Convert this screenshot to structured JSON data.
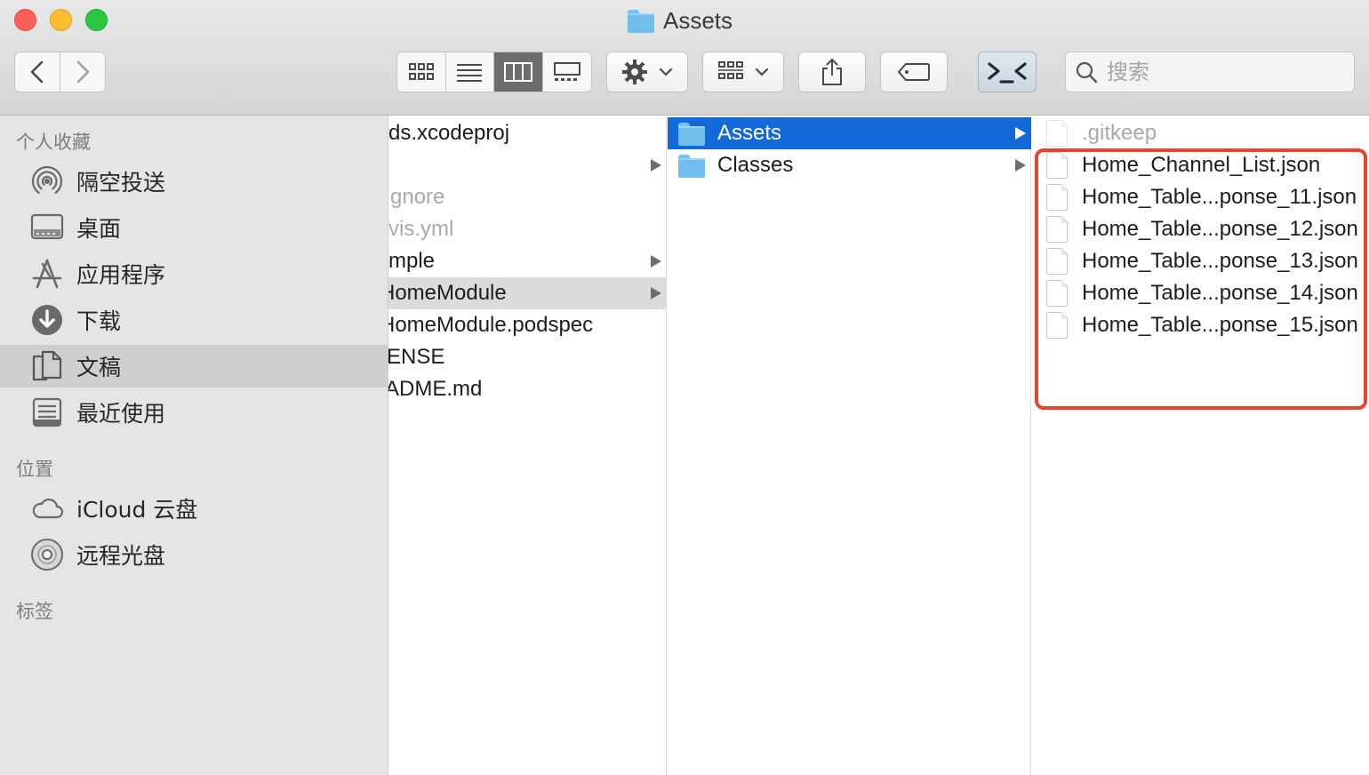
{
  "window": {
    "title": "Assets",
    "title_icon": "folder-icon"
  },
  "toolbar": {
    "back_icon": "chevron-left-icon",
    "forward_icon": "chevron-right-icon",
    "view_modes": [
      "icon-view-icon",
      "list-view-icon",
      "column-view-icon",
      "gallery-view-icon"
    ],
    "active_view": "column-view-icon",
    "action_icon": "gear-icon",
    "group_icon": "grid-group-icon",
    "share_icon": "share-icon",
    "tag_icon": "tag-icon",
    "terminal_icon": "terminal-icon",
    "search_placeholder": "搜索",
    "search_value": ""
  },
  "sidebar": {
    "favorites_header": "个人收藏",
    "favorites": [
      {
        "label": "隔空投送",
        "icon": "airdrop-icon"
      },
      {
        "label": "桌面",
        "icon": "desktop-icon"
      },
      {
        "label": "应用程序",
        "icon": "applications-icon"
      },
      {
        "label": "下载",
        "icon": "downloads-icon"
      },
      {
        "label": "文稿",
        "icon": "documents-icon",
        "selected": true
      },
      {
        "label": "最近使用",
        "icon": "recents-icon"
      }
    ],
    "locations_header": "位置",
    "locations": [
      {
        "label": "iCloud 云盘",
        "icon": "cloud-icon"
      },
      {
        "label": "远程光盘",
        "icon": "disc-icon"
      }
    ],
    "tags_header": "标签"
  },
  "columns": {
    "col1": [
      {
        "name": "ds.xcodeproj",
        "dim": false,
        "arrow": false
      },
      {
        "name": "",
        "dim": false,
        "arrow": true
      },
      {
        "name": "gnore",
        "dim": true,
        "arrow": false
      },
      {
        "name": "vis.yml",
        "dim": true,
        "arrow": false
      },
      {
        "name": "mple",
        "dim": false,
        "arrow": true
      },
      {
        "name": "HomeModule",
        "dim": false,
        "arrow": true,
        "selected": true
      },
      {
        "name": "HomeModule.podspec",
        "dim": false,
        "arrow": false
      },
      {
        "name": "ENSE",
        "dim": false,
        "arrow": false
      },
      {
        "name": "ADME.md",
        "dim": false,
        "arrow": false
      }
    ],
    "col2": [
      {
        "name": "Assets",
        "selected": true
      },
      {
        "name": "Classes",
        "selected": false
      }
    ],
    "col3": [
      {
        "name": ".gitkeep",
        "dim": true
      },
      {
        "name": "Home_Channel_List.json",
        "dim": false
      },
      {
        "name": "Home_Table...ponse_11.json",
        "dim": false
      },
      {
        "name": "Home_Table...ponse_12.json",
        "dim": false
      },
      {
        "name": "Home_Table...ponse_13.json",
        "dim": false
      },
      {
        "name": "Home_Table...ponse_14.json",
        "dim": false
      },
      {
        "name": "Home_Table...ponse_15.json",
        "dim": false
      }
    ]
  },
  "colors": {
    "selection_blue": "#1469d9",
    "annotation_red": "#e8432e",
    "folder_blue": "#6fbeee"
  }
}
